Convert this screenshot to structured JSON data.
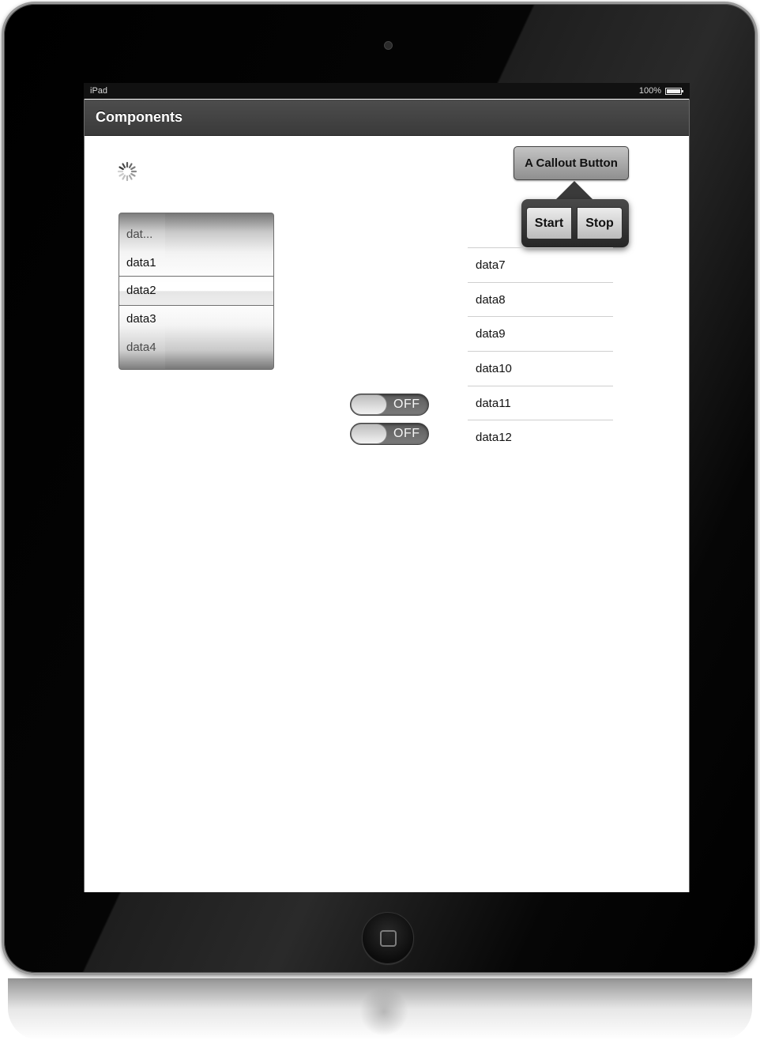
{
  "status_bar": {
    "device": "iPad",
    "battery": "100%"
  },
  "nav_bar": {
    "title": "Components"
  },
  "picker": {
    "rows": [
      "dat...",
      "data1",
      "data2",
      "data3",
      "data4"
    ],
    "selected": "data2"
  },
  "toggles": [
    {
      "label": "OFF",
      "on": false
    },
    {
      "label": "OFF",
      "on": false
    }
  ],
  "callout": {
    "button_label": "A Callout Button",
    "segments": [
      "Start",
      "Stop"
    ]
  },
  "list": {
    "items": [
      "data7",
      "data8",
      "data9",
      "data10",
      "data11",
      "data12"
    ]
  },
  "icons": {
    "spinner": "activity-indicator-icon",
    "battery": "battery-icon",
    "home": "home-square-icon"
  }
}
